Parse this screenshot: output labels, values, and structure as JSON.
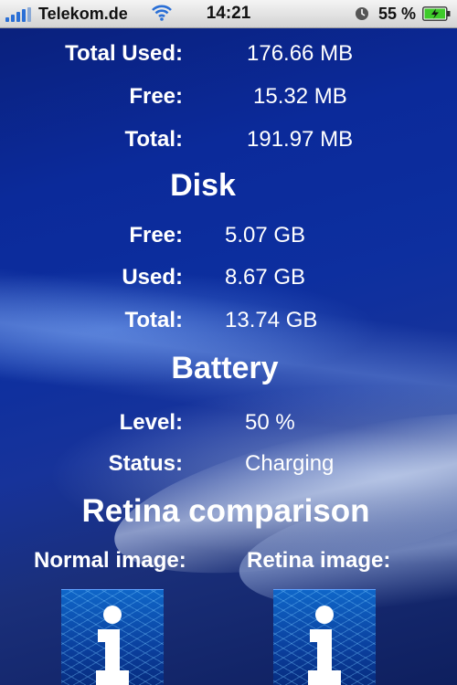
{
  "status_bar": {
    "carrier": "Telekom.de",
    "time": "14:21",
    "battery_percent": "55 %",
    "icons": [
      "signal-icon",
      "wifi-icon",
      "clock-icon",
      "battery-charging-icon"
    ]
  },
  "memory": {
    "rows": [
      {
        "label": "Total Used:",
        "value": "176.66 MB"
      },
      {
        "label": "Free:",
        "value": "15.32 MB"
      },
      {
        "label": "Total:",
        "value": "191.97 MB"
      }
    ]
  },
  "disk": {
    "title": "Disk",
    "rows": [
      {
        "label": "Free:",
        "value": "5.07 GB"
      },
      {
        "label": "Used:",
        "value": "8.67 GB"
      },
      {
        "label": "Total:",
        "value": "13.74 GB"
      }
    ]
  },
  "battery": {
    "title": "Battery",
    "rows": [
      {
        "label": "Level:",
        "value": "50 %"
      },
      {
        "label": "Status:",
        "value": "Charging"
      }
    ]
  },
  "retina": {
    "title": "Retina comparison",
    "normal_label": "Normal image:",
    "retina_label": "Retina image:",
    "image_icon": "info-icon"
  },
  "colors": {
    "text": "#ffffff",
    "background_dark": "#0a1f78",
    "signal_blue": "#2a6fd6",
    "battery_green": "#3ecb2a"
  }
}
